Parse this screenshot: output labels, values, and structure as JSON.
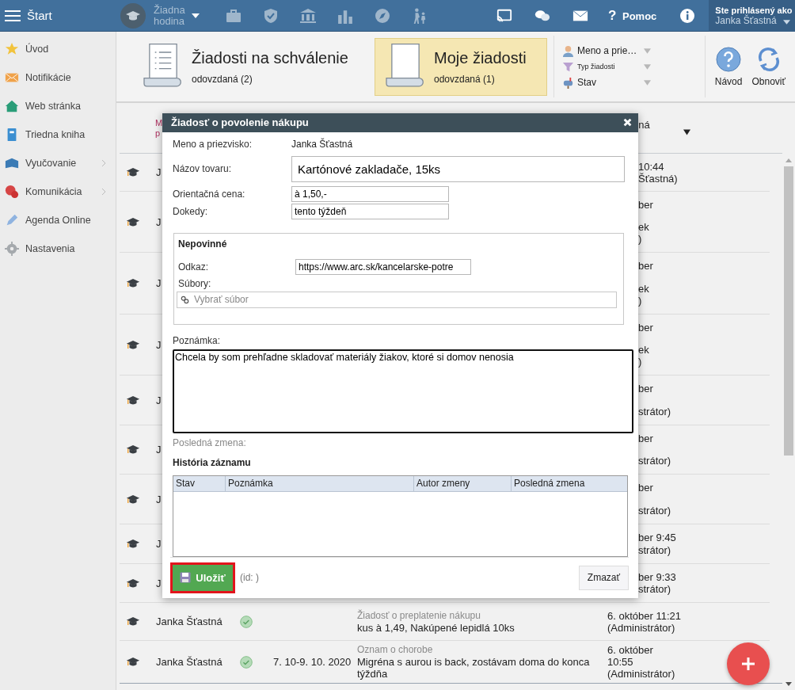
{
  "topbar": {
    "title": "Štart",
    "lesson": "Žiadna hodina",
    "help_icon": "?",
    "help": "Pomoc",
    "user_label": "Ste prihlásený ako",
    "user_name": "Janka Šťastná"
  },
  "sidebar": {
    "items": [
      {
        "label": "Úvod",
        "kind": "star",
        "submenu": false
      },
      {
        "label": "Notifikácie",
        "kind": "envelope",
        "submenu": false
      },
      {
        "label": "Web stránka",
        "kind": "house",
        "submenu": false
      },
      {
        "label": "Triedna kniha",
        "kind": "notebook",
        "submenu": false
      },
      {
        "label": "Vyučovanie",
        "kind": "book",
        "submenu": true
      },
      {
        "label": "Komunikácia",
        "kind": "chat",
        "submenu": true
      },
      {
        "label": "Agenda Online",
        "kind": "pen",
        "submenu": false
      },
      {
        "label": "Nastavenia",
        "kind": "gear",
        "submenu": false
      }
    ]
  },
  "header": {
    "tabs": [
      {
        "title": "Žiadosti na schválenie",
        "subtitle": "odovzdaná (2)",
        "selected": false
      },
      {
        "title": "Moje žiadosti",
        "subtitle": "odovzdaná (1)",
        "selected": true
      }
    ],
    "filters": [
      {
        "label": "Meno a prie…",
        "kind": "person",
        "small": false
      },
      {
        "label": "Typ žiadosti",
        "kind": "funnel",
        "small": true
      },
      {
        "label": "Stav",
        "kind": "mailbox",
        "small": false
      }
    ],
    "actions": [
      {
        "label": "Návod",
        "kind": "help"
      },
      {
        "label": "Obnoviť",
        "kind": "refresh"
      }
    ]
  },
  "list": {
    "column_1": [
      "M",
      "p"
    ],
    "column_2": "ná",
    "rows": [
      {
        "name": "J",
        "modified": [
          "10:44",
          "Šťastná)"
        ]
      },
      {
        "name": "J",
        "modified": [
          "ber",
          "ek",
          ")"
        ]
      },
      {
        "name": "J",
        "modified": [
          "ber",
          "ek",
          ")"
        ]
      },
      {
        "name": "J",
        "modified": [
          "ber",
          "ek",
          ")"
        ]
      },
      {
        "name": "J",
        "modified": [
          "ber",
          "strátor)"
        ]
      },
      {
        "name": "J",
        "modified": [
          "ber",
          "strátor)"
        ]
      },
      {
        "name": "J",
        "modified": [
          "ber",
          "strátor)"
        ]
      },
      {
        "name": "J",
        "modified": [
          "ber 9:45",
          "strátor)"
        ]
      },
      {
        "name": "J",
        "modified": [
          "ber 9:33",
          "strátor)"
        ]
      },
      {
        "name": "Janka Šťastná",
        "approved": true,
        "type": "Žiadosť o preplatenie nákupu",
        "text": "kus à 1,49, Nakúpené lepidlá 10ks",
        "modified": [
          "6. október 11:21",
          "(Administrátor)"
        ]
      },
      {
        "name": "Janka Šťastná",
        "approved": true,
        "dates": "7. 10-9. 10. 2020",
        "type": "Oznam o chorobe",
        "text": "Migréna s aurou is back, zostávam doma do konca týždňa",
        "modified": [
          "6. október",
          "10:55",
          "(Administrátor)"
        ]
      }
    ]
  },
  "dialog": {
    "title": "Žiadosť o povolenie nákupu",
    "name_label": "Meno a priezvisko:",
    "name_value": "Janka Šťastná",
    "fields": [
      {
        "label": "Názov tovaru:",
        "value": "Kartónové zakladače, 15ks",
        "kind": "large"
      },
      {
        "label": "Orientačná cena:",
        "value": "à 1,50,-",
        "kind": "small"
      },
      {
        "label": "Dokedy:",
        "value": "tento týždeň",
        "kind": "small"
      }
    ],
    "optional": {
      "legend": "Nepovinné",
      "link_label": "Odkaz:",
      "link_value": "https://www.arc.sk/kancelarske-potre",
      "files_label": "Súbory:",
      "files_placeholder": "Vybrať súbor"
    },
    "note_label": "Poznámka:",
    "note_value": "Chcela by som prehľadne skladovať materiály žiakov, ktoré si domov nenosia",
    "last_change_label": "Posledná zmena:",
    "history_title": "História záznamu",
    "history_columns": [
      "Stav",
      "Poznámka",
      "Autor zmeny",
      "Posledná zmena"
    ],
    "save": "Uložiť",
    "save_highlighted": true,
    "id_text": "(id: )",
    "delete": "Zmazať"
  }
}
